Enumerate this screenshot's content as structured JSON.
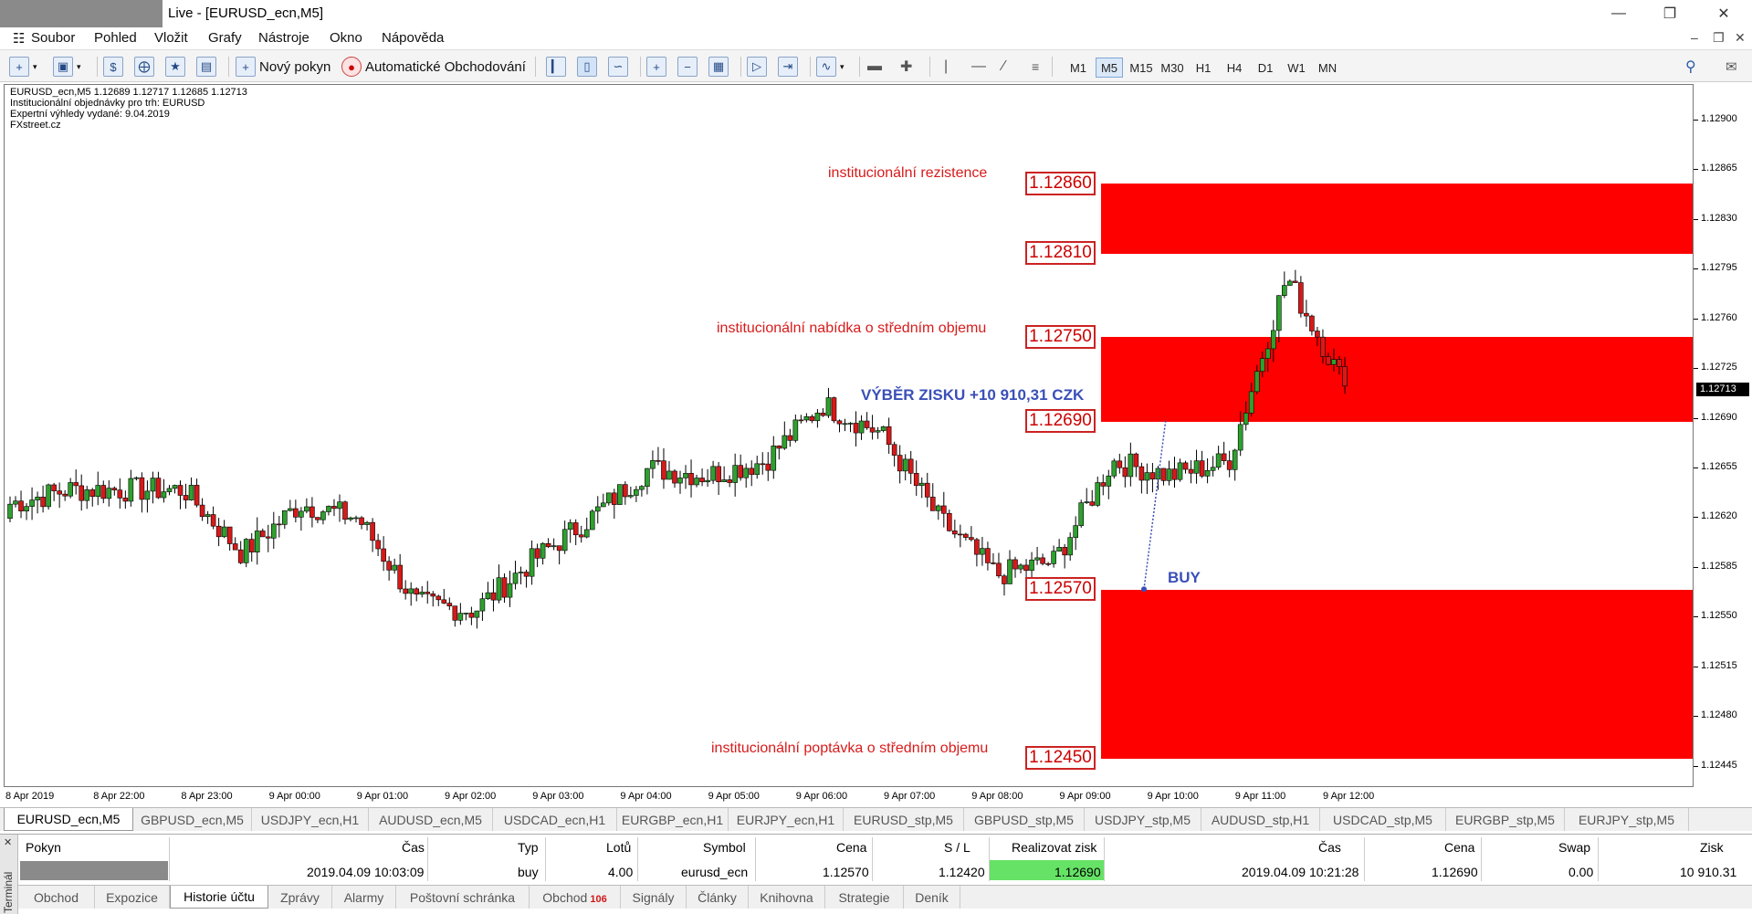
{
  "window": {
    "title": "Live - [EURUSD_ecn,M5]"
  },
  "menu": [
    "Soubor",
    "Pohled",
    "Vložit",
    "Grafy",
    "Nástroje",
    "Okno",
    "Nápověda"
  ],
  "toolbar": {
    "new_order": "Nový pokyn",
    "auto_trading": "Automatické Obchodování",
    "timeframes": [
      "M1",
      "M5",
      "M15",
      "M30",
      "H1",
      "H4",
      "D1",
      "W1",
      "MN"
    ],
    "active_timeframe": "M5"
  },
  "chart": {
    "info_lines": [
      "EURUSD_ecn,M5  1.12689 1.12717 1.12685 1.12713",
      "Institucionální objednávky pro trh: EURUSD",
      "Expertní výhledy vydané: 9.04.2019",
      "FXstreet.cz"
    ],
    "current_price": "1.12713",
    "zone_texts": {
      "resistance": "institucionální rezistence",
      "mid_offer": "institucionální nabídka o středním objemu",
      "mid_demand": "institucionální poptávka o středním objemu"
    },
    "levels": {
      "l1": "1.12860",
      "l2": "1.12810",
      "l3": "1.12750",
      "l4": "1.12690",
      "l5": "1.12570",
      "l6": "1.12450"
    },
    "profit_text": "VÝBĚR ZISKU +10 910,31 CZK",
    "buy_text": "BUY",
    "colors": {
      "zone": "#ff0000",
      "bull": "#2ea02e",
      "bear": "#d71919",
      "annotation": "#3a4fb8"
    }
  },
  "chart_data": {
    "type": "candlestick",
    "symbol": "EURUSD_ecn",
    "timeframe": "M5",
    "y_ticks": [
      "1.12900",
      "1.12865",
      "1.12830",
      "1.12795",
      "1.12760",
      "1.12725",
      "1.12690",
      "1.12655",
      "1.12620",
      "1.12585",
      "1.12550",
      "1.12515",
      "1.12480",
      "1.12445"
    ],
    "x_ticks": [
      "8 Apr 2019",
      "8 Apr 22:00",
      "8 Apr 23:00",
      "9 Apr 00:00",
      "9 Apr 01:00",
      "9 Apr 02:00",
      "9 Apr 03:00",
      "9 Apr 04:00",
      "9 Apr 05:00",
      "9 Apr 06:00",
      "9 Apr 07:00",
      "9 Apr 08:00",
      "9 Apr 09:00",
      "9 Apr 10:00",
      "9 Apr 11:00",
      "9 Apr 12:00"
    ],
    "ylim": [
      1.1243,
      1.12925
    ],
    "zones": [
      {
        "from": 1.1281,
        "to": 1.1286,
        "label": "institucionální rezistence"
      },
      {
        "from": 1.1269,
        "to": 1.1275,
        "label": "institucionální nabídka o středním objemu"
      },
      {
        "from": 1.1245,
        "to": 1.1257,
        "label": "institucionální poptávka o středním objemu"
      }
    ],
    "trade": {
      "entry": 1.1257,
      "exit": 1.1269,
      "side": "buy"
    },
    "path": [
      [
        1.126,
        1.1262,
        1.126,
        1.1263
      ],
      [
        1.1261,
        1.126,
        1.1262,
        1.1264
      ],
      [
        1.1262,
        1.1263,
        1.126,
        1.1264
      ],
      [
        1.1265,
        1.1262,
        1.1264,
        1.1264
      ],
      [
        1.1259,
        1.1259,
        1.1258,
        1.12595
      ],
      [
        1.1258,
        1.126,
        1.1261,
        1.1263
      ],
      [
        1.126,
        1.1259,
        1.126,
        1.1262
      ],
      [
        1.1263,
        1.1262,
        1.1261,
        1.1256
      ],
      [
        1.1256,
        1.1257,
        1.1255,
        1.12555
      ],
      [
        1.1255,
        1.1256,
        1.12555,
        1.1259
      ],
      [
        1.1259,
        1.1258,
        1.126,
        1.1262
      ],
      [
        1.1265,
        1.1262,
        1.1264,
        1.12655
      ],
      [
        1.1266,
        1.1267,
        1.1266,
        1.1265
      ],
      [
        1.1264,
        1.1266,
        1.1265,
        1.1266
      ],
      [
        1.1265,
        1.1266,
        1.1268,
        1.127
      ],
      [
        1.1268,
        1.1269,
        1.1267,
        1.1268
      ],
      [
        1.1267,
        1.1265,
        1.1264,
        1.1262
      ],
      [
        1.1262,
        1.1263,
        1.126,
        1.1258
      ],
      [
        1.1259,
        1.1264,
        1.1264,
        1.1259
      ],
      [
        1.1256,
        1.1258,
        1.1264,
        1.1266
      ],
      [
        1.1265,
        1.1264,
        1.1262,
        1.1265
      ],
      [
        1.1269,
        1.127,
        1.1265,
        1.1266
      ],
      [
        1.1266,
        1.1272,
        1.1274,
        1.1279
      ],
      [
        1.1278,
        1.1278,
        1.127,
        1.12713
      ]
    ]
  },
  "chart_tabs": [
    "EURUSD_ecn,M5",
    "GBPUSD_ecn,M5",
    "USDJPY_ecn,H1",
    "AUDUSD_ecn,M5",
    "USDCAD_ecn,H1",
    "EURGBP_ecn,H1",
    "EURJPY_ecn,H1",
    "EURUSD_stp,M5",
    "GBPUSD_stp,M5",
    "USDJPY_stp,M5",
    "AUDUSD_stp,H1",
    "USDCAD_stp,M5",
    "EURGBP_stp,M5",
    "EURJPY_stp,M5"
  ],
  "terminal": {
    "side_label": "Terminál",
    "headers": [
      "Pokyn",
      "Čas",
      "Typ",
      "Lotů",
      "Symbol",
      "Cena",
      "S / L",
      "Realizovat zisk",
      "Čas",
      "Cena",
      "Swap",
      "Zisk"
    ],
    "row": {
      "time_open": "2019.04.09 10:03:09",
      "type": "buy",
      "lots": "4.00",
      "symbol": "eurusd_ecn",
      "price_open": "1.12570",
      "sl": "1.12420",
      "tp": "1.12690",
      "time_close": "2019.04.09 10:21:28",
      "price_close": "1.12690",
      "swap": "0.00",
      "profit": "10 910.31"
    },
    "tabs": [
      "Obchod",
      "Expozice",
      "Historie účtu",
      "Zprávy",
      "Alarmy",
      "Poštovní schránka",
      "Obchod",
      "Signály",
      "Články",
      "Knihovna",
      "Strategie",
      "Deník"
    ],
    "active_tab": "Historie účtu",
    "obchod_badge": "106"
  }
}
